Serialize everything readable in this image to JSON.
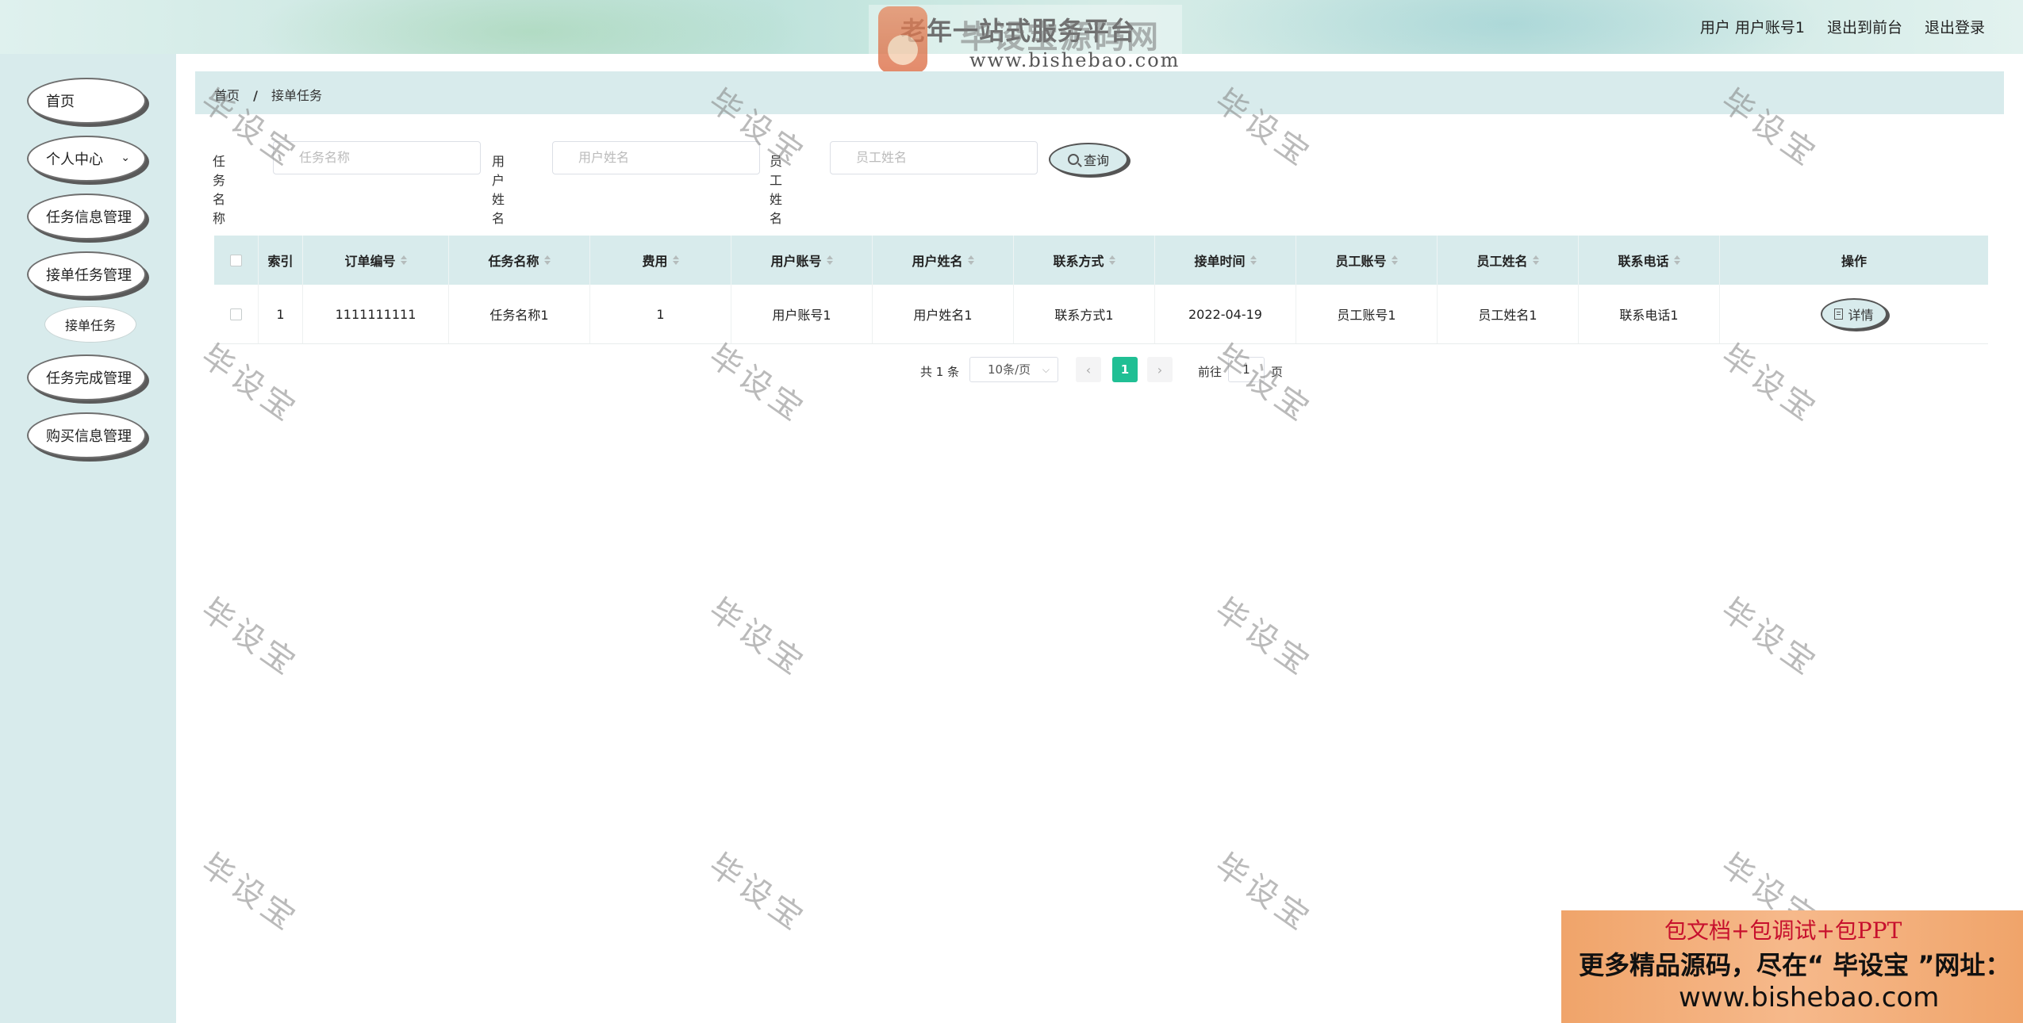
{
  "header": {
    "title": "老年一站式服务平台",
    "user_label": "用户 用户账号1",
    "to_front": "退出到前台",
    "logout": "退出登录"
  },
  "logo_watermark": {
    "text": "毕设宝源码网",
    "url": "www.bishebao.com"
  },
  "sidebar": {
    "items": [
      {
        "label": "首页"
      },
      {
        "label": "个人中心"
      },
      {
        "label": "任务信息管理"
      },
      {
        "label": "接单任务管理"
      },
      {
        "label": "任务完成管理"
      },
      {
        "label": "购买信息管理"
      }
    ],
    "sub_items": [
      {
        "label": "接单任务"
      }
    ]
  },
  "breadcrumb": {
    "home": "首页",
    "separator": "/",
    "current": "接单任务"
  },
  "search": {
    "task_name_label": "任务名称",
    "task_name_placeholder": "任务名称",
    "user_name_label": "用户姓名",
    "user_name_placeholder": "用户姓名",
    "staff_name_label": "员工姓名",
    "staff_name_placeholder": "员工姓名",
    "query_label": "查询"
  },
  "table": {
    "columns": [
      "索引",
      "订单编号",
      "任务名称",
      "费用",
      "用户账号",
      "用户姓名",
      "联系方式",
      "接单时间",
      "员工账号",
      "员工姓名",
      "联系电话",
      "操作"
    ],
    "rows": [
      {
        "index": "1",
        "order_no": "1111111111",
        "task_name": "任务名称1",
        "fee": "1",
        "user_account": "用户账号1",
        "user_name": "用户姓名1",
        "contact": "联系方式1",
        "accept_time": "2022-04-19",
        "staff_account": "员工账号1",
        "staff_name": "员工姓名1",
        "phone": "联系电话1",
        "action_label": "详情"
      }
    ]
  },
  "pagination": {
    "total": "共 1 条",
    "page_size": "10条/页",
    "prev": "‹",
    "current_page": "1",
    "next": "›",
    "goto": "前往",
    "goto_value": "1",
    "page_suffix": "页"
  },
  "watermark_text": "毕设宝",
  "ad": {
    "line1": "包文档+包调试+包PPT",
    "line2": "更多精品源码，尽在“ 毕设宝 ”网址：",
    "line3": "www.bishebao.com"
  },
  "colors": {
    "accent_green": "#20bf94",
    "panel_bg": "#d8ebec",
    "ad_orange": "#f0a46a"
  }
}
